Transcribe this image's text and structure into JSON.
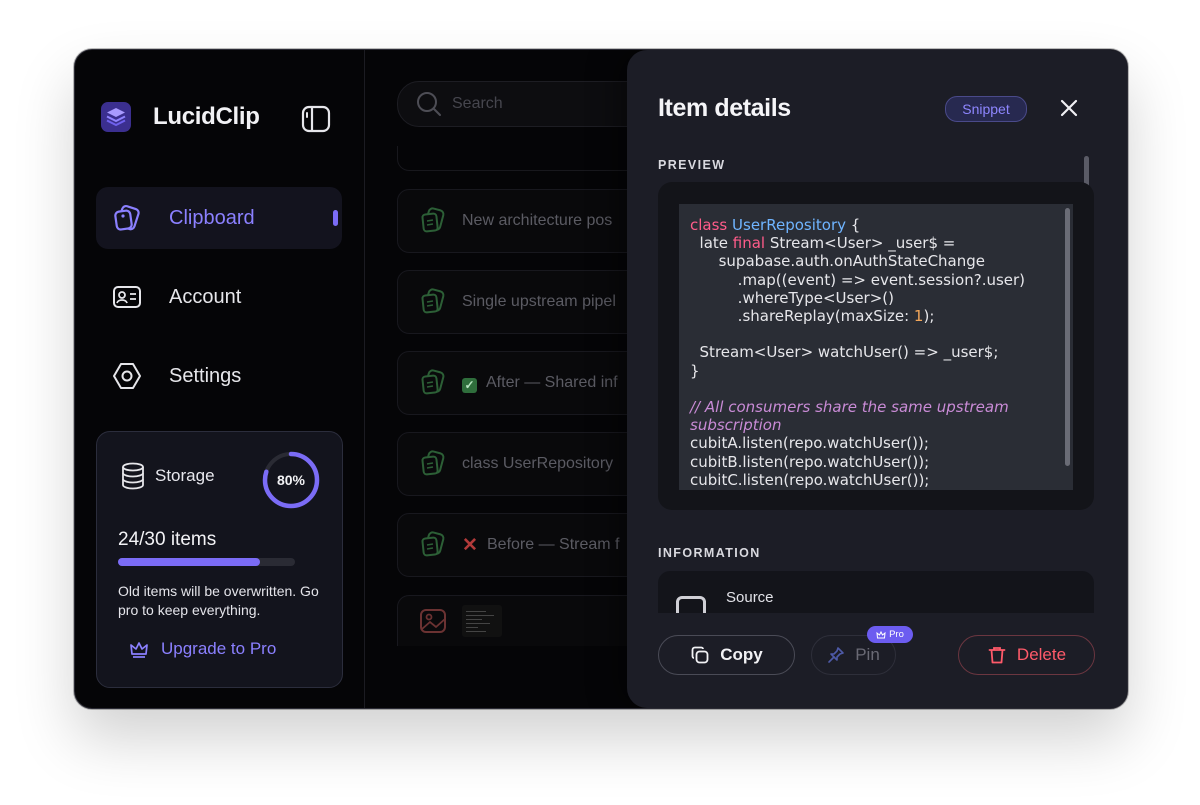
{
  "app": {
    "name": "LucidClip"
  },
  "sidebar": {
    "items": [
      {
        "label": "Clipboard",
        "icon": "clipboard-icon",
        "active": true
      },
      {
        "label": "Account",
        "icon": "id-card-icon",
        "active": false
      },
      {
        "label": "Settings",
        "icon": "hexagon-gear-icon",
        "active": false
      }
    ],
    "storage": {
      "title": "Storage",
      "percent_label": "80%",
      "percent": 80,
      "count_label": "24/30 items",
      "used": 24,
      "capacity": 30,
      "note": "Old items will be overwritten. Go pro to keep everything.",
      "upgrade_label": "Upgrade to Pro"
    }
  },
  "search": {
    "placeholder": "Search"
  },
  "clips": [
    {
      "text": "New architecture pos",
      "mark": ""
    },
    {
      "text": "Single upstream pipel",
      "mark": ""
    },
    {
      "text": "After — Shared inf",
      "mark": "check"
    },
    {
      "text": "class UserRepository",
      "mark": ""
    },
    {
      "text": "Before — Stream f",
      "mark": "cross"
    }
  ],
  "details": {
    "title": "Item details",
    "badge": "Snippet",
    "preview_label": "PREVIEW",
    "information_label": "INFORMATION",
    "source_label": "Source",
    "actions": {
      "copy": "Copy",
      "pin": "Pin",
      "pin_badge": "Pro",
      "delete": "Delete"
    }
  },
  "colors": {
    "accent": "#7b6cf6",
    "danger": "#ff5a6a",
    "panel_bg": "#1c1d26",
    "window_bg": "#050507"
  }
}
